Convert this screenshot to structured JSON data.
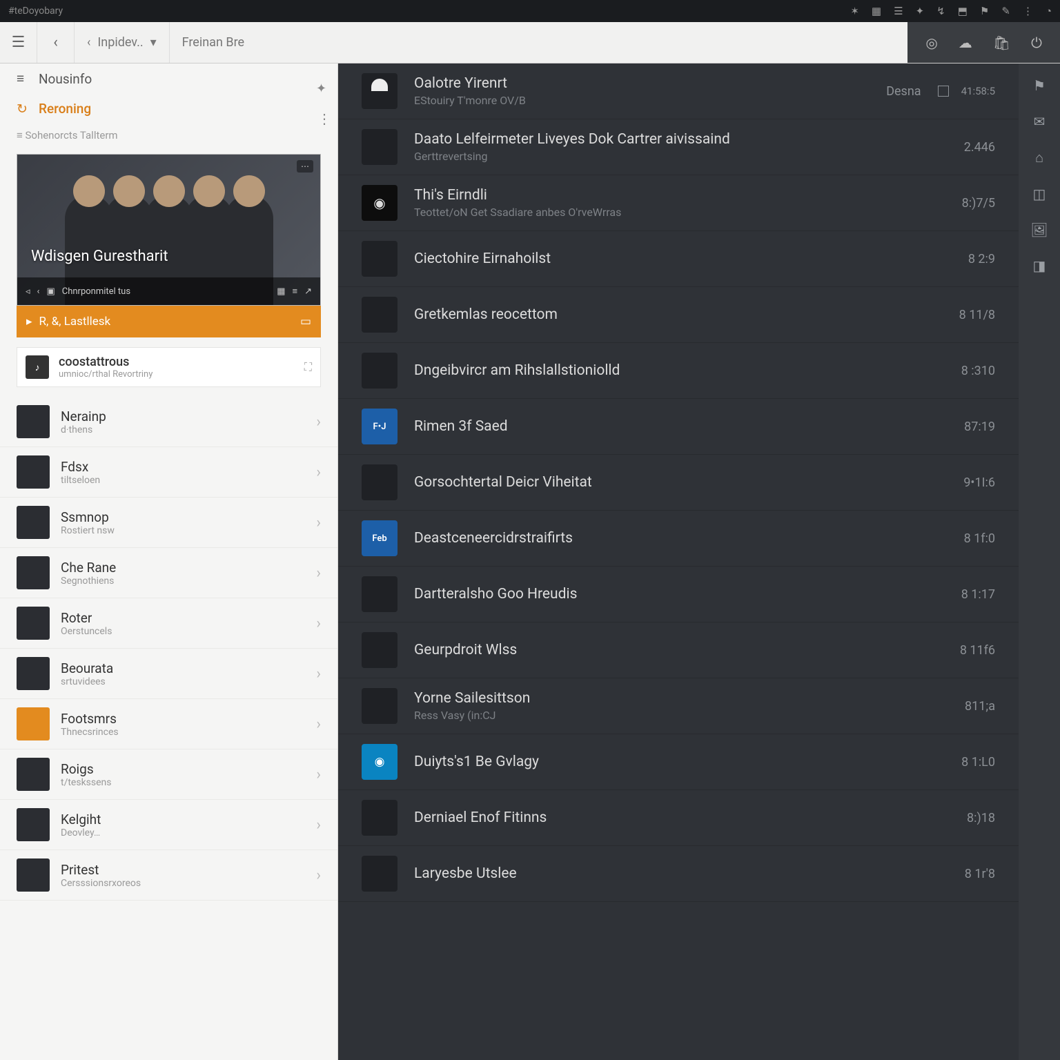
{
  "titlebar": {
    "app": "#teDoyobary"
  },
  "topbar": {
    "crumb1": "Inpidev..",
    "crumb2": "Freinan Bre"
  },
  "sidebar": {
    "nav": [
      {
        "label": "Nousinfo",
        "active": false
      },
      {
        "label": "Reroning",
        "active": true
      }
    ],
    "section": "Sohenorcts Tallterm",
    "hero": {
      "title": "Wdisgen Gurestharit",
      "tag": "⋯",
      "subtitle": "Chnrponmitel tus"
    },
    "orange": "R, &, Lastllesk",
    "category": {
      "title": "coostattrous",
      "subtitle": "umnioc/rthal Revortriny"
    },
    "items": [
      {
        "title": "Nerainp",
        "subtitle": "d·thens"
      },
      {
        "title": "Fdsx",
        "subtitle": "tiltseloen"
      },
      {
        "title": "Ssmnop",
        "subtitle": "Rostiert nsw"
      },
      {
        "title": "Che Rane",
        "subtitle": "Segnothiens"
      },
      {
        "title": "Roter",
        "subtitle": "Oerstuncels"
      },
      {
        "title": "Beourata",
        "subtitle": "srtuvidees"
      },
      {
        "title": "Footsmrs",
        "subtitle": "Thnecsrinces",
        "orange": true
      },
      {
        "title": "Roigs",
        "subtitle": "t/teskssens"
      },
      {
        "title": "Kelgiht",
        "subtitle": "Deovley…"
      },
      {
        "title": "Pritest",
        "subtitle": "Cersssionsrxoreos"
      }
    ]
  },
  "tracks": [
    {
      "title": "Oalotre Yirenrt",
      "subtitle": "EStouiry T'monre OV/B",
      "dur": "Desna",
      "ext": "41:58:5",
      "art": "white"
    },
    {
      "title": "Daato Lelfeirmeter Liveyes Dok Cartrer aivissaind",
      "subtitle": "Gerttrevertsing",
      "dur": "2.446",
      "art": ""
    },
    {
      "title": "Thi's Eirndli",
      "subtitle": "Teottet/oN Get Ssadiare anbes O'rveWrras",
      "dur": "8:)7/5",
      "art": "dark-eye"
    },
    {
      "title": "Ciectohire Eirnahoilst",
      "subtitle": "",
      "dur": "8 2:9",
      "art": ""
    },
    {
      "title": "Gretkemlas reocettom",
      "subtitle": "",
      "dur": "8 11/8",
      "art": ""
    },
    {
      "title": "Dngeibvircr am Rihslallstioniolld",
      "subtitle": "",
      "dur": "8 :310",
      "art": ""
    },
    {
      "title": "Rimen 3f Saed",
      "subtitle": "",
      "dur": "87:19",
      "art": "blue",
      "artText": "F•J"
    },
    {
      "title": "Gorsochtertal Deicr Viheitat",
      "subtitle": "",
      "dur": "9•1I:6",
      "art": ""
    },
    {
      "title": "Deastceneercidrstraifirts",
      "subtitle": "",
      "dur": "8 1f:0",
      "art": "blue",
      "artText": "Feb"
    },
    {
      "title": "Dartteralsho Goo Hreudis",
      "subtitle": "",
      "dur": "8 1:17",
      "art": ""
    },
    {
      "title": "Geurpdroit Wlss",
      "subtitle": "",
      "dur": "8 11f6",
      "art": ""
    },
    {
      "title": "Yorne Sailesittson",
      "subtitle": "Ress Vasy (in:CJ",
      "dur": "811;a",
      "art": ""
    },
    {
      "title": "Duiyts's1 Be Gvlagy",
      "subtitle": "",
      "dur": "8 1:L0",
      "art": "cyan",
      "artText": "◉"
    },
    {
      "title": "Derniael Enof Fitinns",
      "subtitle": "",
      "dur": "8:)18",
      "art": ""
    },
    {
      "title": "Laryesbe Utslee",
      "subtitle": "",
      "dur": "8 1r'8",
      "art": ""
    }
  ]
}
